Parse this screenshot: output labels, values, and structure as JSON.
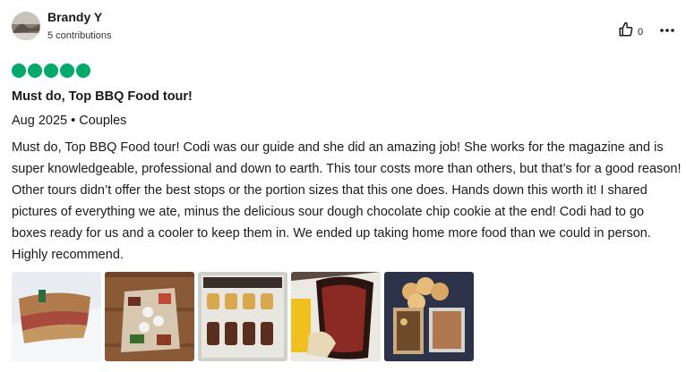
{
  "review": {
    "author": {
      "name": "Brandy Y",
      "contributions": "5 contributions"
    },
    "helpful_count": "0",
    "rating": 5,
    "title": "Must do, Top BBQ Food tour!",
    "date": "Aug 2025",
    "trip_type": "Couples",
    "body": "Must do, Top BBQ Food tour! Codi was our guide and she did an amazing job! She works for the magazine and is super knowledgeable, professional and down to earth. This tour costs more than others, but that’s for a good reason! Other tours didn’t offer the best stops or the portion sizes that this one does. Hands down this worth it! I shared pictures of everything we ate, minus the delicious sour dough chocolate chip cookie at the end! Codi had to go boxes ready for us and a cooler to keep them in. We ended up taking home more food than we could in person. Highly recommend."
  },
  "icons": {
    "helpful": "thumbs-up-icon",
    "more": "ellipsis-icon",
    "rating": "rating-bubble-icon"
  },
  "colors": {
    "rating_green": "#00aa6c",
    "text": "#1a1a1a"
  }
}
